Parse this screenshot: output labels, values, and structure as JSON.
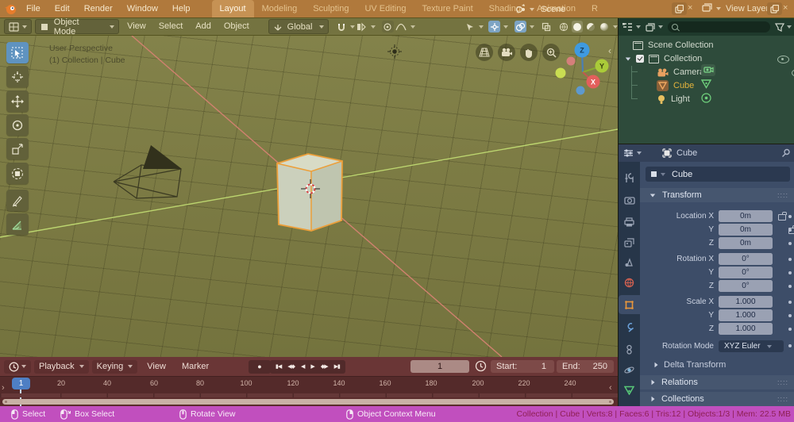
{
  "topbar": {
    "menus": [
      "File",
      "Edit",
      "Render",
      "Window",
      "Help"
    ],
    "tabs": [
      "Layout",
      "Modeling",
      "Sculpting",
      "UV Editing",
      "Texture Paint",
      "Shading",
      "Animation",
      "R"
    ],
    "active_tab": "Layout",
    "scene_selector": {
      "label": "Scene"
    },
    "view_layer_selector": {
      "label": "View Layer"
    },
    "close_glyph": "×"
  },
  "viewport": {
    "header": {
      "mode": "Object Mode",
      "menus": [
        "View",
        "Select",
        "Add",
        "Object"
      ],
      "orientation": "Global"
    },
    "overlay": {
      "line1": "User Perspective",
      "line2": "(1) Collection | Cube"
    },
    "gizmo": {
      "x": "X",
      "y": "Y",
      "z": "Z"
    }
  },
  "outliner": {
    "items": [
      {
        "label": "Scene Collection"
      },
      {
        "label": "Collection"
      },
      {
        "label": "Camera"
      },
      {
        "label": "Cube"
      },
      {
        "label": "Light"
      }
    ]
  },
  "properties": {
    "breadcrumb": "Cube",
    "id_field": "Cube",
    "transform": {
      "title": "Transform",
      "rows": [
        {
          "label": "Location X",
          "value": "0m"
        },
        {
          "label": "Y",
          "value": "0m"
        },
        {
          "label": "Z",
          "value": "0m"
        },
        {
          "label": "Rotation X",
          "value": "0°"
        },
        {
          "label": "Y",
          "value": "0°"
        },
        {
          "label": "Z",
          "value": "0°"
        },
        {
          "label": "Scale X",
          "value": "1.000"
        },
        {
          "label": "Y",
          "value": "1.000"
        },
        {
          "label": "Z",
          "value": "1.000"
        }
      ],
      "rotation_mode": {
        "label": "Rotation Mode",
        "value": "XYZ Euler"
      },
      "subpanel": "Delta Transform"
    },
    "panels": [
      "Relations",
      "Collections"
    ]
  },
  "timeline": {
    "menus": [
      "Playback",
      "Keying",
      "View",
      "Marker"
    ],
    "current_frame": "1",
    "start_label": "Start:",
    "start_value": "1",
    "end_label": "End:",
    "end_value": "250",
    "playhead": "1",
    "ticks": [
      "20",
      "40",
      "60",
      "80",
      "100",
      "120",
      "140",
      "160",
      "180",
      "200",
      "220",
      "240"
    ]
  },
  "statusbar": {
    "hints": [
      "Select",
      "Box Select",
      "Rotate View",
      "Object Context Menu"
    ],
    "stats": "Collection | Cube | Verts:8 | Faces:6 | Tris:12 | Objects:1/3 | Mem: 22.5 MB"
  },
  "icons": {
    "record": "●",
    "jump_start": "▮◀",
    "prev_key": "◀◆",
    "play_back": "◀",
    "play": "▶",
    "next_key": "◆▶",
    "jump_end": "▶▮",
    "sidebar_left": "‹",
    "sidebar_right": "›"
  },
  "colors": {
    "topbar_bg": "#b0793c",
    "viewport_bg": "#7b7a43",
    "selection_outline": "#ec9f3a",
    "axis_x": "#d0816f",
    "axis_y": "#bcd56f",
    "timeline_bg": "#6a3636",
    "outliner_bg": "#2e4b3b",
    "properties_bg": "#3d4d68",
    "statusbar_bg": "#c14fbe",
    "playhead_bg": "#4e7fc4"
  }
}
